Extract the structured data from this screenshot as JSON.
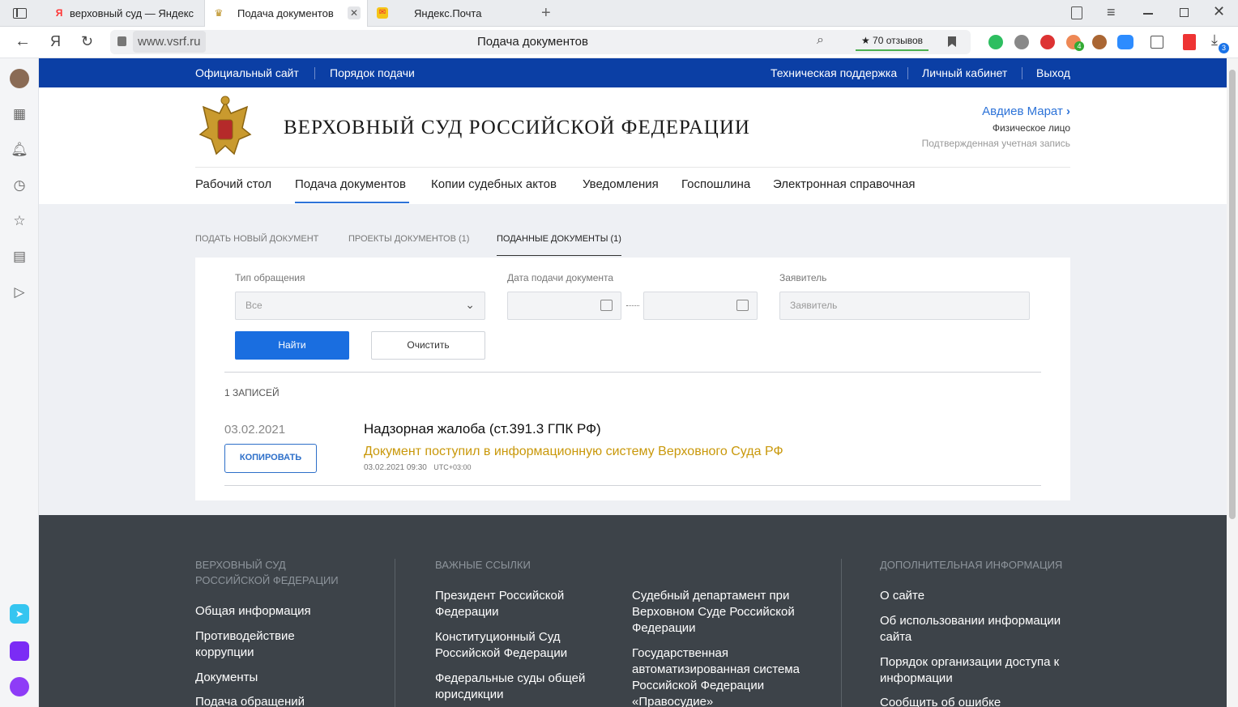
{
  "browser": {
    "tabs": [
      {
        "title": "верховный суд — Яндекс"
      },
      {
        "title": "Подача документов"
      },
      {
        "title": "Яндекс.Почта"
      }
    ],
    "url": "www.vsrf.ru",
    "page_title": "Подача документов",
    "reviews": "70 отзывов",
    "downloads_badge": "3",
    "ext_badge": "4",
    "logo_letter": "Я"
  },
  "topnav": {
    "left": [
      "Официальный сайт",
      "Порядок подачи"
    ],
    "right": [
      "Техническая поддержка",
      "Личный кабинет",
      "Выход"
    ]
  },
  "header": {
    "title": "ВЕРХОВНЫЙ СУД РОССИЙСКОЙ ФЕДЕРАЦИИ",
    "user_name": "Авдиев Марат",
    "user_type": "Физическое лицо",
    "user_status": "Подтвержденная учетная запись"
  },
  "mainnav": [
    "Рабочий стол",
    "Подача документов",
    "Копии судебных актов",
    "Уведомления",
    "Госпошлина",
    "Электронная справочная"
  ],
  "subtabs": [
    "ПОДАТЬ НОВЫЙ ДОКУМЕНТ",
    "ПРОЕКТЫ ДОКУМЕНТОВ (1)",
    "ПОДАННЫЕ ДОКУМЕНТЫ (1)"
  ],
  "filters": {
    "type_label": "Тип обращения",
    "type_value": "Все",
    "date_label": "Дата подачи документа",
    "applicant_label": "Заявитель",
    "applicant_placeholder": "Заявитель",
    "find": "Найти",
    "clear": "Очистить"
  },
  "results": {
    "count": "1 ЗАПИСЕЙ",
    "items": [
      {
        "date": "03.02.2021",
        "copy": "КОПИРОВАТЬ",
        "title": "Надзорная жалоба (ст.391.3 ГПК РФ)",
        "status": "Документ поступил в информационную систему Верховного Суда РФ",
        "timestamp": "03.02.2021 09:30",
        "tz": "UTC+03:00"
      }
    ]
  },
  "footer": {
    "col1_head": [
      "ВЕРХОВНЫЙ СУД",
      "РОССИЙСКОЙ ФЕДЕРАЦИИ"
    ],
    "col1_links": [
      [
        "Общая информация"
      ],
      [
        "Противодействие",
        "коррупции"
      ],
      [
        "Документы"
      ],
      [
        "Подача обращений"
      ]
    ],
    "col2_head": "ВАЖНЫЕ ССЫЛКИ",
    "col2_links": [
      [
        "Президент Российской",
        "Федерации"
      ],
      [
        "Конституционный Суд",
        "Российской Федерации"
      ],
      [
        "Федеральные суды общей",
        "юрисдикции"
      ]
    ],
    "col3_links": [
      [
        "Судебный департамент при",
        "Верховном Суде Российской",
        "Федерации"
      ],
      [
        "Государственная",
        "автоматизированная система",
        "Российской Федерации",
        "«Правосудие»"
      ]
    ],
    "col4_head": "ДОПОЛНИТЕЛЬНАЯ ИНФОРМАЦИЯ",
    "col4_links": [
      [
        "О сайте"
      ],
      [
        "Об использовании информации",
        "сайта"
      ],
      [
        "Порядок организации доступа к",
        "информации"
      ],
      [
        "Сообщить об ошибке"
      ]
    ]
  },
  "colors": {
    "nav_blue": "#0b3fa5",
    "btn_blue": "#1a6ee0",
    "status_gold": "#c9980a",
    "footer_bg": "#3d4349"
  }
}
